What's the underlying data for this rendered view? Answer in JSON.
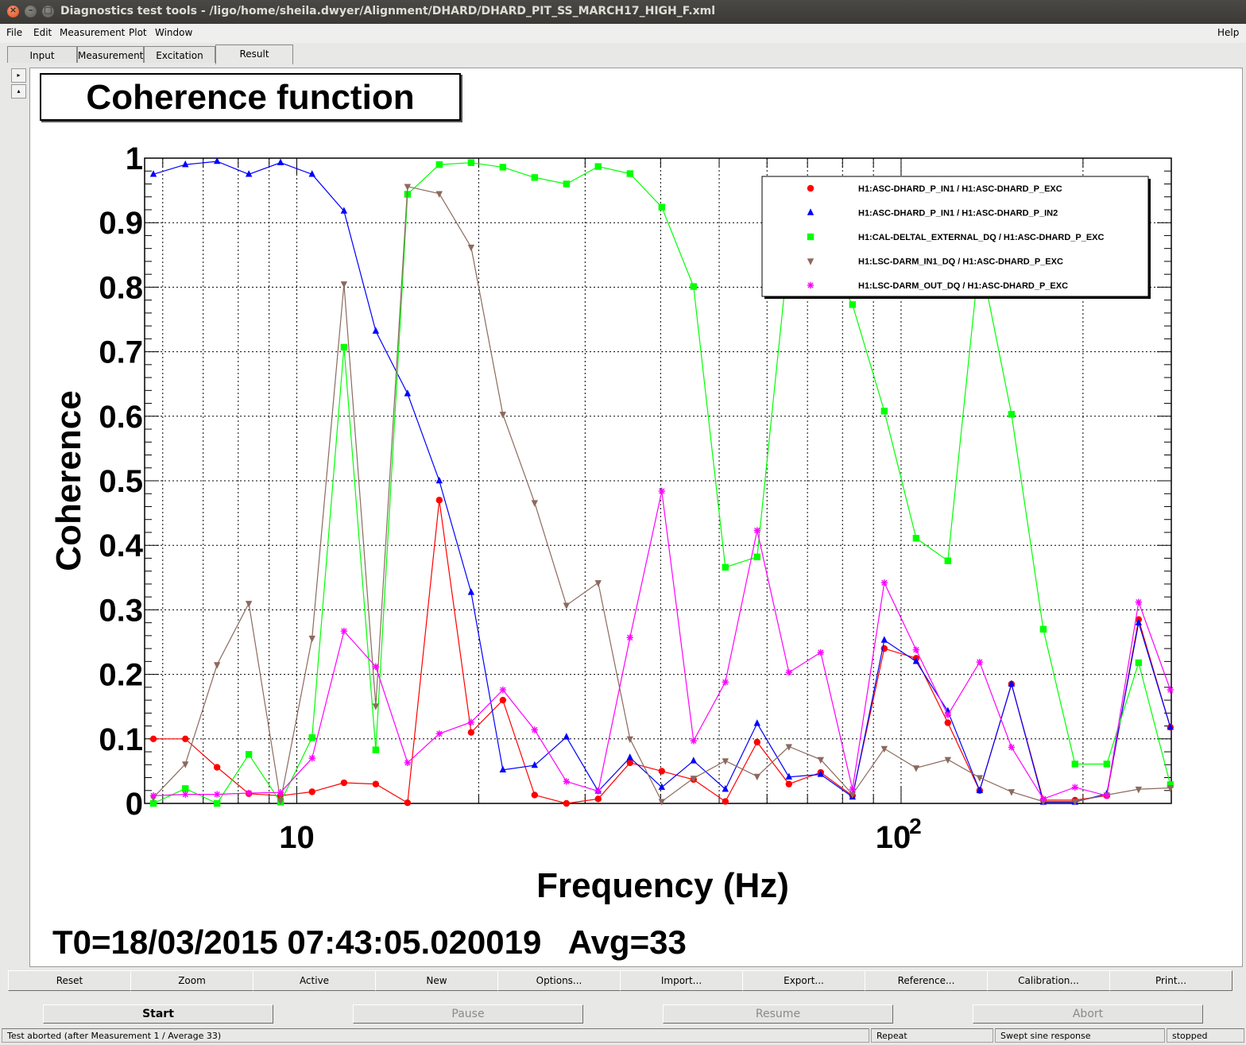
{
  "window": {
    "title": "Diagnostics test tools - /ligo/home/sheila.dwyer/Alignment/DHARD/DHARD_PIT_SS_MARCH17_HIGH_F.xml"
  },
  "menu": {
    "file": "File",
    "edit": "Edit",
    "measurement": "Measurement",
    "plot": "Plot",
    "window": "Window",
    "help": "Help"
  },
  "tabs": {
    "input": "Input",
    "measurement": "Measurement",
    "excitation": "Excitation",
    "result": "Result"
  },
  "plot": {
    "title": "Coherence function",
    "info": "T0=18/03/2015 07:43:05.020019   Avg=33"
  },
  "toolbar": {
    "reset": "Reset",
    "zoom": "Zoom",
    "active": "Active",
    "new": "New",
    "options": "Options...",
    "import": "Import...",
    "export": "Export...",
    "reference": "Reference...",
    "calibration": "Calibration...",
    "print": "Print..."
  },
  "controls": {
    "start": "Start",
    "pause": "Pause",
    "resume": "Resume",
    "abort": "Abort"
  },
  "status": {
    "message": "Test aborted (after Measurement 1 / Average 33)",
    "repeat": "Repeat",
    "mode": "Swept sine response",
    "state": "stopped"
  },
  "chart_data": {
    "type": "line",
    "title": "Coherence function",
    "xlabel": "Frequency (Hz)",
    "ylabel": "Coherence",
    "xscale": "log",
    "xlim": [
      5.6,
      280
    ],
    "ylim": [
      0,
      1
    ],
    "yticks": [
      "0",
      "0.1",
      "0.2",
      "0.3",
      "0.4",
      "0.5",
      "0.6",
      "0.7",
      "0.8",
      "0.9",
      "1"
    ],
    "xticks": [
      {
        "value": 10,
        "label": "10"
      },
      {
        "value": 100,
        "label": "10",
        "sup": "2"
      }
    ],
    "grid": true,
    "legend_position": "top-right",
    "x": [
      5.79,
      6.54,
      7.38,
      8.33,
      9.4,
      10.6,
      11.97,
      13.51,
      15.25,
      17.21,
      19.43,
      21.93,
      24.75,
      27.94,
      31.53,
      35.59,
      40.18,
      45.35,
      51.19,
      57.78,
      65.22,
      73.62,
      83.1,
      93.8,
      105.9,
      119.5,
      134.9,
      152.3,
      171.9,
      194.0,
      219.0,
      247.2,
      279.0
    ],
    "series": [
      {
        "name": "H1:ASC-DHARD_P_IN1 / H1:ASC-DHARD_P_EXC",
        "color": "#ff0000",
        "marker": "circle",
        "values": [
          0.1,
          0.1,
          0.056,
          0.015,
          0.012,
          0.018,
          0.032,
          0.03,
          0.001,
          0.47,
          0.11,
          0.16,
          0.013,
          0.0,
          0.007,
          0.063,
          0.05,
          0.037,
          0.003,
          0.095,
          0.03,
          0.048,
          0.012,
          0.24,
          0.225,
          0.125,
          0.02,
          0.185,
          0.005,
          0.005,
          0.012,
          0.285,
          0.118
        ]
      },
      {
        "name": "H1:ASC-DHARD_P_IN1 / H1:ASC-DHARD_P_IN2",
        "color": "#0000ff",
        "marker": "triangle",
        "values": [
          0.975,
          0.99,
          0.995,
          0.975,
          0.993,
          0.975,
          0.918,
          0.732,
          0.635,
          0.5,
          0.327,
          0.052,
          0.059,
          0.103,
          0.019,
          0.071,
          0.025,
          0.066,
          0.022,
          0.124,
          0.041,
          0.045,
          0.01,
          0.253,
          0.22,
          0.143,
          0.02,
          0.185,
          0.002,
          0.002,
          0.015,
          0.28,
          0.118
        ]
      },
      {
        "name": "H1:CAL-DELTAL_EXTERNAL_DQ / H1:ASC-DHARD_P_EXC",
        "color": "#00ff00",
        "marker": "square",
        "values": [
          0.0,
          0.023,
          0.0,
          0.076,
          0.002,
          0.102,
          0.707,
          0.083,
          0.944,
          0.99,
          0.993,
          0.986,
          0.97,
          0.96,
          0.987,
          0.976,
          0.924,
          0.801,
          0.366,
          0.382,
          0.86,
          0.86,
          0.773,
          0.608,
          0.411,
          0.376,
          0.85,
          0.603,
          0.27,
          0.061,
          0.061,
          0.218,
          0.029
        ]
      },
      {
        "name": "H1:LSC-DARM_IN1_DQ / H1:ASC-DHARD_P_EXC",
        "color": "#8b6a5e",
        "marker": "triangle-down",
        "values": [
          0.009,
          0.061,
          0.215,
          0.31,
          0.004,
          0.256,
          0.805,
          0.151,
          0.956,
          0.945,
          0.862,
          0.603,
          0.466,
          0.307,
          0.342,
          0.1,
          0.003,
          0.039,
          0.066,
          0.042,
          0.088,
          0.068,
          0.014,
          0.085,
          0.055,
          0.068,
          0.04,
          0.018,
          0.003,
          0.003,
          0.013,
          0.022,
          0.024
        ]
      },
      {
        "name": "H1:LSC-DARM_OUT_DQ / H1:ASC-DHARD_P_EXC",
        "color": "#ff00ff",
        "marker": "star",
        "values": [
          0.012,
          0.014,
          0.014,
          0.016,
          0.017,
          0.07,
          0.267,
          0.212,
          0.063,
          0.108,
          0.126,
          0.176,
          0.114,
          0.034,
          0.019,
          0.257,
          0.484,
          0.097,
          0.188,
          0.423,
          0.203,
          0.234,
          0.022,
          0.342,
          0.238,
          0.137,
          0.219,
          0.087,
          0.007,
          0.025,
          0.012,
          0.312,
          0.176
        ]
      }
    ]
  }
}
